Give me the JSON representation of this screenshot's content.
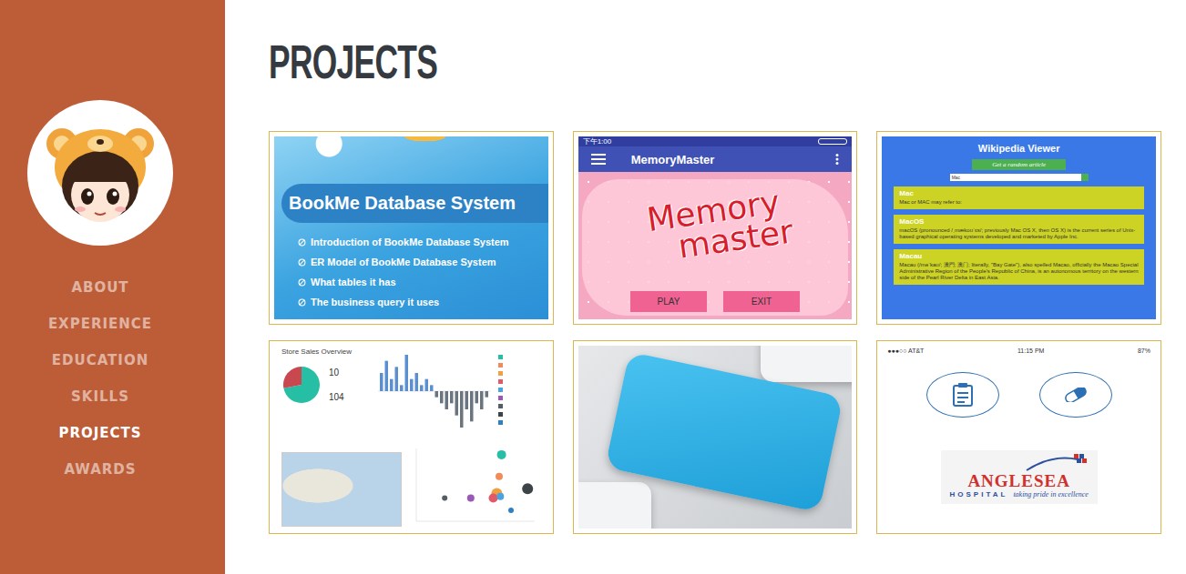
{
  "sidebar": {
    "nav": [
      {
        "label": "ABOUT",
        "selected": false
      },
      {
        "label": "EXPERIENCE",
        "selected": false
      },
      {
        "label": "EDUCATION",
        "selected": false
      },
      {
        "label": "SKILLS",
        "selected": false
      },
      {
        "label": "PROJECTS",
        "selected": true
      },
      {
        "label": "AWARDS",
        "selected": false
      }
    ]
  },
  "page": {
    "title": "PROJECTS"
  },
  "projects": [
    {
      "kind": "slide",
      "title": "BookMe Database System",
      "bullets": [
        "Introduction of BookMe Database System",
        "ER Model of BookMe Database System",
        "What tables it has",
        "The business query it uses"
      ]
    },
    {
      "kind": "memory-app",
      "status_time": "下午1:00",
      "app_title": "MemoryMaster",
      "logo_lines": [
        "Memory",
        "master"
      ],
      "buttons": [
        "PLAY",
        "EXIT"
      ]
    },
    {
      "kind": "wiki-app",
      "title": "Wikipedia Viewer",
      "random_button": "Get a random article",
      "search_value": "Mac",
      "results": [
        {
          "title": "Mac",
          "snippet": "Mac or MAC may refer to:"
        },
        {
          "title": "MacOS",
          "snippet": "macOS (pronounced /ˌmækoʊˈɛs/; previously Mac OS X, then OS X) is the current series of Unix-based graphical operating systems developed and marketed by Apple Inc."
        },
        {
          "title": "Macau",
          "snippet": "Macau (/məˈkaʊ/; 澳門; 澳门; literally, \"Bay Gate\"), also spelled Macao, officially the Macao Special Administrative Region of the People's Republic of China, is an autonomous territory on the western side of the Pearl River Delta in East Asia."
        }
      ]
    },
    {
      "kind": "dashboard",
      "title": "Store Sales Overview",
      "kpis": [
        "10",
        "104"
      ],
      "pie": [
        {
          "value": 72,
          "color": "#26bfa5"
        },
        {
          "value": 28,
          "color": "#c9474e"
        }
      ],
      "bars": [
        3,
        5,
        2,
        4,
        1,
        6,
        2,
        3,
        1,
        2,
        1,
        -1,
        -2,
        -3,
        -2,
        -4,
        -6,
        -3,
        -5,
        -2,
        -3,
        -1
      ],
      "points": [
        {
          "x": 7.2,
          "y": 8.6,
          "r": 5,
          "color": "#26bfa5"
        },
        {
          "x": 7.0,
          "y": 5.8,
          "r": 4,
          "color": "#f08c5a"
        },
        {
          "x": 6.8,
          "y": 3.6,
          "r": 6,
          "color": "#f0a040"
        },
        {
          "x": 6.5,
          "y": 3.0,
          "r": 5,
          "color": "#e05a6a"
        },
        {
          "x": 7.1,
          "y": 3.2,
          "r": 4,
          "color": "#4aa3df"
        },
        {
          "x": 4.6,
          "y": 3.0,
          "r": 4,
          "color": "#9b59b6"
        },
        {
          "x": 2.4,
          "y": 3.0,
          "r": 3,
          "color": "#555e66"
        },
        {
          "x": 9.4,
          "y": 4.2,
          "r": 6,
          "color": "#3d4448"
        },
        {
          "x": 8.0,
          "y": 1.4,
          "r": 3,
          "color": "#2f80c0"
        }
      ]
    },
    {
      "kind": "photo"
    },
    {
      "kind": "hospital-app",
      "carrier": "●●●○○ AT&T",
      "time": "11:15 PM",
      "battery": "87%",
      "logo_name": "ANGLESEA",
      "logo_sub": "HOSPITAL",
      "tagline": "taking pride in excellence"
    }
  ]
}
